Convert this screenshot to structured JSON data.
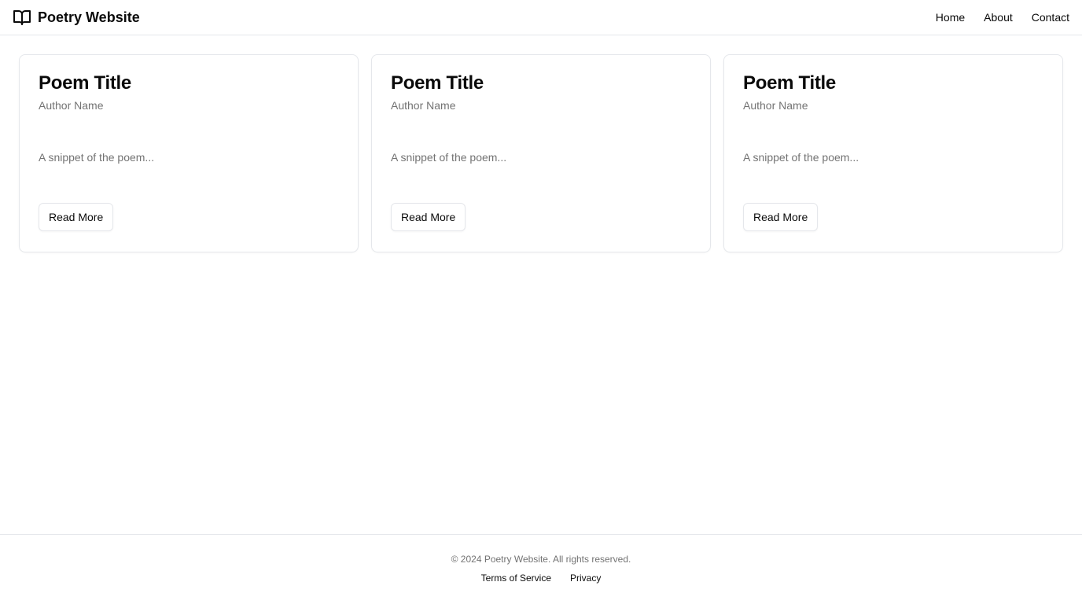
{
  "header": {
    "brand_icon": "book-open-icon",
    "brand_name": "Poetry Website",
    "nav": [
      {
        "label": "Home"
      },
      {
        "label": "About"
      },
      {
        "label": "Contact"
      }
    ]
  },
  "cards": [
    {
      "title": "Poem Title",
      "author": "Author Name",
      "snippet": "A snippet of the poem...",
      "button": "Read More"
    },
    {
      "title": "Poem Title",
      "author": "Author Name",
      "snippet": "A snippet of the poem...",
      "button": "Read More"
    },
    {
      "title": "Poem Title",
      "author": "Author Name",
      "snippet": "A snippet of the poem...",
      "button": "Read More"
    }
  ],
  "footer": {
    "copyright": "© 2024 Poetry Website. All rights reserved.",
    "links": [
      {
        "label": "Terms of Service"
      },
      {
        "label": "Privacy"
      }
    ]
  },
  "colors": {
    "text": "#0a0a0a",
    "muted": "#737373",
    "border": "#e5e7eb",
    "background": "#ffffff"
  }
}
